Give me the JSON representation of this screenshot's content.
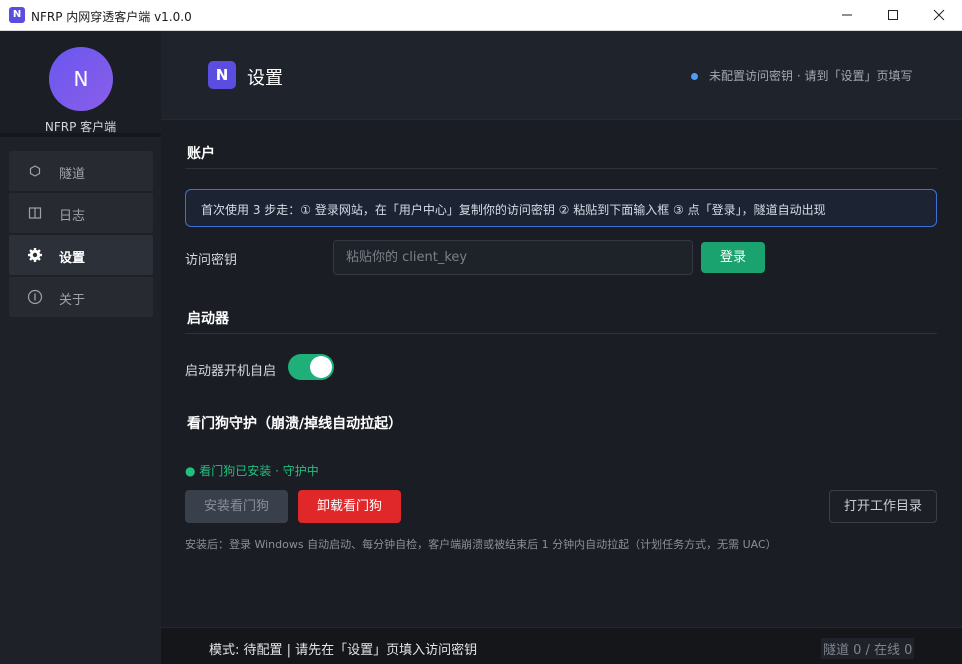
{
  "window": {
    "icon_letter": "N",
    "title": "NFRP 内网穿透客户端 v1.0.0"
  },
  "sidebar": {
    "avatar_letter": "N",
    "brand": "NFRP 客户端",
    "items": [
      {
        "label": "隧道",
        "icon": "hexagon-icon"
      },
      {
        "label": "日志",
        "icon": "log-book-icon"
      },
      {
        "label": "设置",
        "icon": "gear-icon",
        "active": true
      },
      {
        "label": "关于",
        "icon": "info-circle-icon"
      }
    ]
  },
  "header": {
    "logo_letter": "N",
    "title": "设置",
    "status": "未配置访问密钥 · 请到「设置」页填写"
  },
  "account": {
    "title": "账户",
    "info": "首次使用 3 步走：① 登录网站，在「用户中心」复制你的访问密钥  ② 粘贴到下面输入框  ③ 点「登录」，隧道自动出现",
    "key_label": "访问密钥",
    "key_value": "",
    "key_placeholder": "粘贴你的 client_key",
    "login_label": "登录"
  },
  "launcher": {
    "title": "启动器",
    "autostart_label": "启动器开机自启",
    "autostart_on": true
  },
  "watchdog": {
    "title": "看门狗守护（崩溃/掉线自动拉起）",
    "status": "● 看门狗已安装 · 守护中",
    "install_label": "安装看门狗",
    "uninstall_label": "卸载看门狗",
    "workdir_label": "打开工作目录",
    "hint": "安装后：登录 Windows 自动启动、每分钟自检，客户端崩溃或被结束后 1 分钟内自动拉起（计划任务方式，无需 UAC）"
  },
  "footer": {
    "mode": "模式: 待配置 | 请先在「设置」页填入访问密钥",
    "count": "隧道 0 / 在线 0"
  },
  "colors": {
    "accent": "#5b4de0",
    "success": "#1aa36e",
    "danger": "#e0282b",
    "info": "#4f9cf7"
  }
}
